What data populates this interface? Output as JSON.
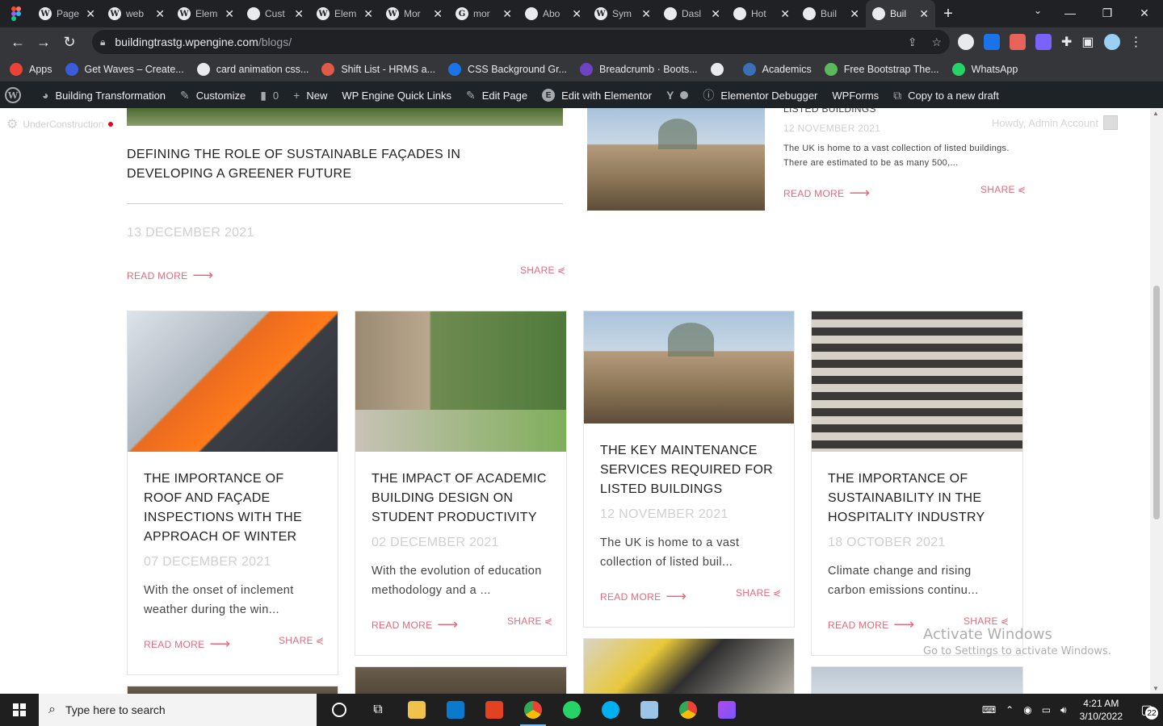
{
  "tabs": [
    {
      "label": "Page",
      "icon": "wordpress-icon"
    },
    {
      "label": "web",
      "icon": "wordpress-icon"
    },
    {
      "label": "Elem",
      "icon": "wordpress-icon"
    },
    {
      "label": "Cust",
      "icon": "custom-icon"
    },
    {
      "label": "Elem",
      "icon": "wordpress-icon"
    },
    {
      "label": "Mor",
      "icon": "wordpress-icon"
    },
    {
      "label": "mor",
      "icon": "google-icon"
    },
    {
      "label": "Abo",
      "icon": "globe-icon"
    },
    {
      "label": "Sym",
      "icon": "wordpress-icon"
    },
    {
      "label": "Dasl",
      "icon": "globe-icon"
    },
    {
      "label": "Hot",
      "icon": "globe-icon"
    },
    {
      "label": "Buil",
      "icon": "globe-icon"
    },
    {
      "label": "Buil",
      "icon": "globe-icon",
      "active": true
    }
  ],
  "address": {
    "domain": "buildingtrastg.wpengine.com",
    "path": "/blogs/"
  },
  "bookmarks": [
    {
      "label": "Apps",
      "color": "#ea4335"
    },
    {
      "label": "Get Waves – Create...",
      "color": "#3b5bdb"
    },
    {
      "label": "card animation css...",
      "color": "#e8eaed"
    },
    {
      "label": "Shift List - HRMS a...",
      "color": "#e05a47"
    },
    {
      "label": "CSS Background Gr...",
      "color": "#1a73e8"
    },
    {
      "label": "Breadcrumb · Boots...",
      "color": "#6f42c1"
    },
    {
      "label": "",
      "color": "#e8eaed"
    },
    {
      "label": "Academics",
      "color": "#3b6fb6"
    },
    {
      "label": "Free Bootstrap The...",
      "color": "#5cb85c"
    },
    {
      "label": "WhatsApp",
      "color": "#25d366"
    }
  ],
  "wpbar": {
    "site": "Building Transformation",
    "customize": "Customize",
    "comments": "0",
    "new": "New",
    "quick_links": "WP Engine Quick Links",
    "edit_page": "Edit Page",
    "elementor": "Edit with Elementor",
    "debugger": "Elementor Debugger",
    "wpforms": "WPForms",
    "copy_draft": "Copy to a new draft"
  },
  "page": {
    "under_construction": "UnderConstruction",
    "howdy": "Howdy, Admin Account",
    "read_more": "READ MORE",
    "share": "SHARE",
    "featured_left": {
      "title": "DEFINING THE ROLE OF SUSTAINABLE FAÇADES IN DEVELOPING A GREENER FUTURE",
      "date": "13 DECEMBER 2021"
    },
    "featured_right": {
      "title_partial": "LISTED BUILDINGS",
      "date": "12 NOVEMBER 2021",
      "excerpt": "The UK is home to a vast collection of listed buildings. There are estimated to be as many 500,..."
    },
    "cards": [
      {
        "title": "THE IMPORTANCE OF ROOF AND FAÇADE INSPECTIONS WITH THE APPROACH OF WINTER",
        "date": "07 DECEMBER 2021",
        "excerpt": "With the onset of inclement weather during the win..."
      },
      {
        "title": "THE IMPACT OF ACADEMIC BUILDING DESIGN ON STUDENT PRODUCTIVITY",
        "date": "02 DECEMBER 2021",
        "excerpt": "With the evolution of education methodology and a ..."
      },
      {
        "title": "THE KEY MAINTENANCE SERVICES REQUIRED FOR LISTED BUILDINGS",
        "date": "12 NOVEMBER 2021",
        "excerpt": "The UK is home to a vast collection of listed buil..."
      },
      {
        "title": "THE IMPORTANCE OF SUSTAINABILITY IN THE HOSPITALITY INDUSTRY",
        "date": "18 OCTOBER 2021",
        "excerpt": "Climate change and rising carbon emissions continu..."
      }
    ]
  },
  "watermark": {
    "line1": "Activate Windows",
    "line2": "Go to Settings to activate Windows."
  },
  "taskbar": {
    "search_placeholder": "Type here to search",
    "time": "4:21 AM",
    "date": "3/10/2022",
    "notifications": "22"
  }
}
